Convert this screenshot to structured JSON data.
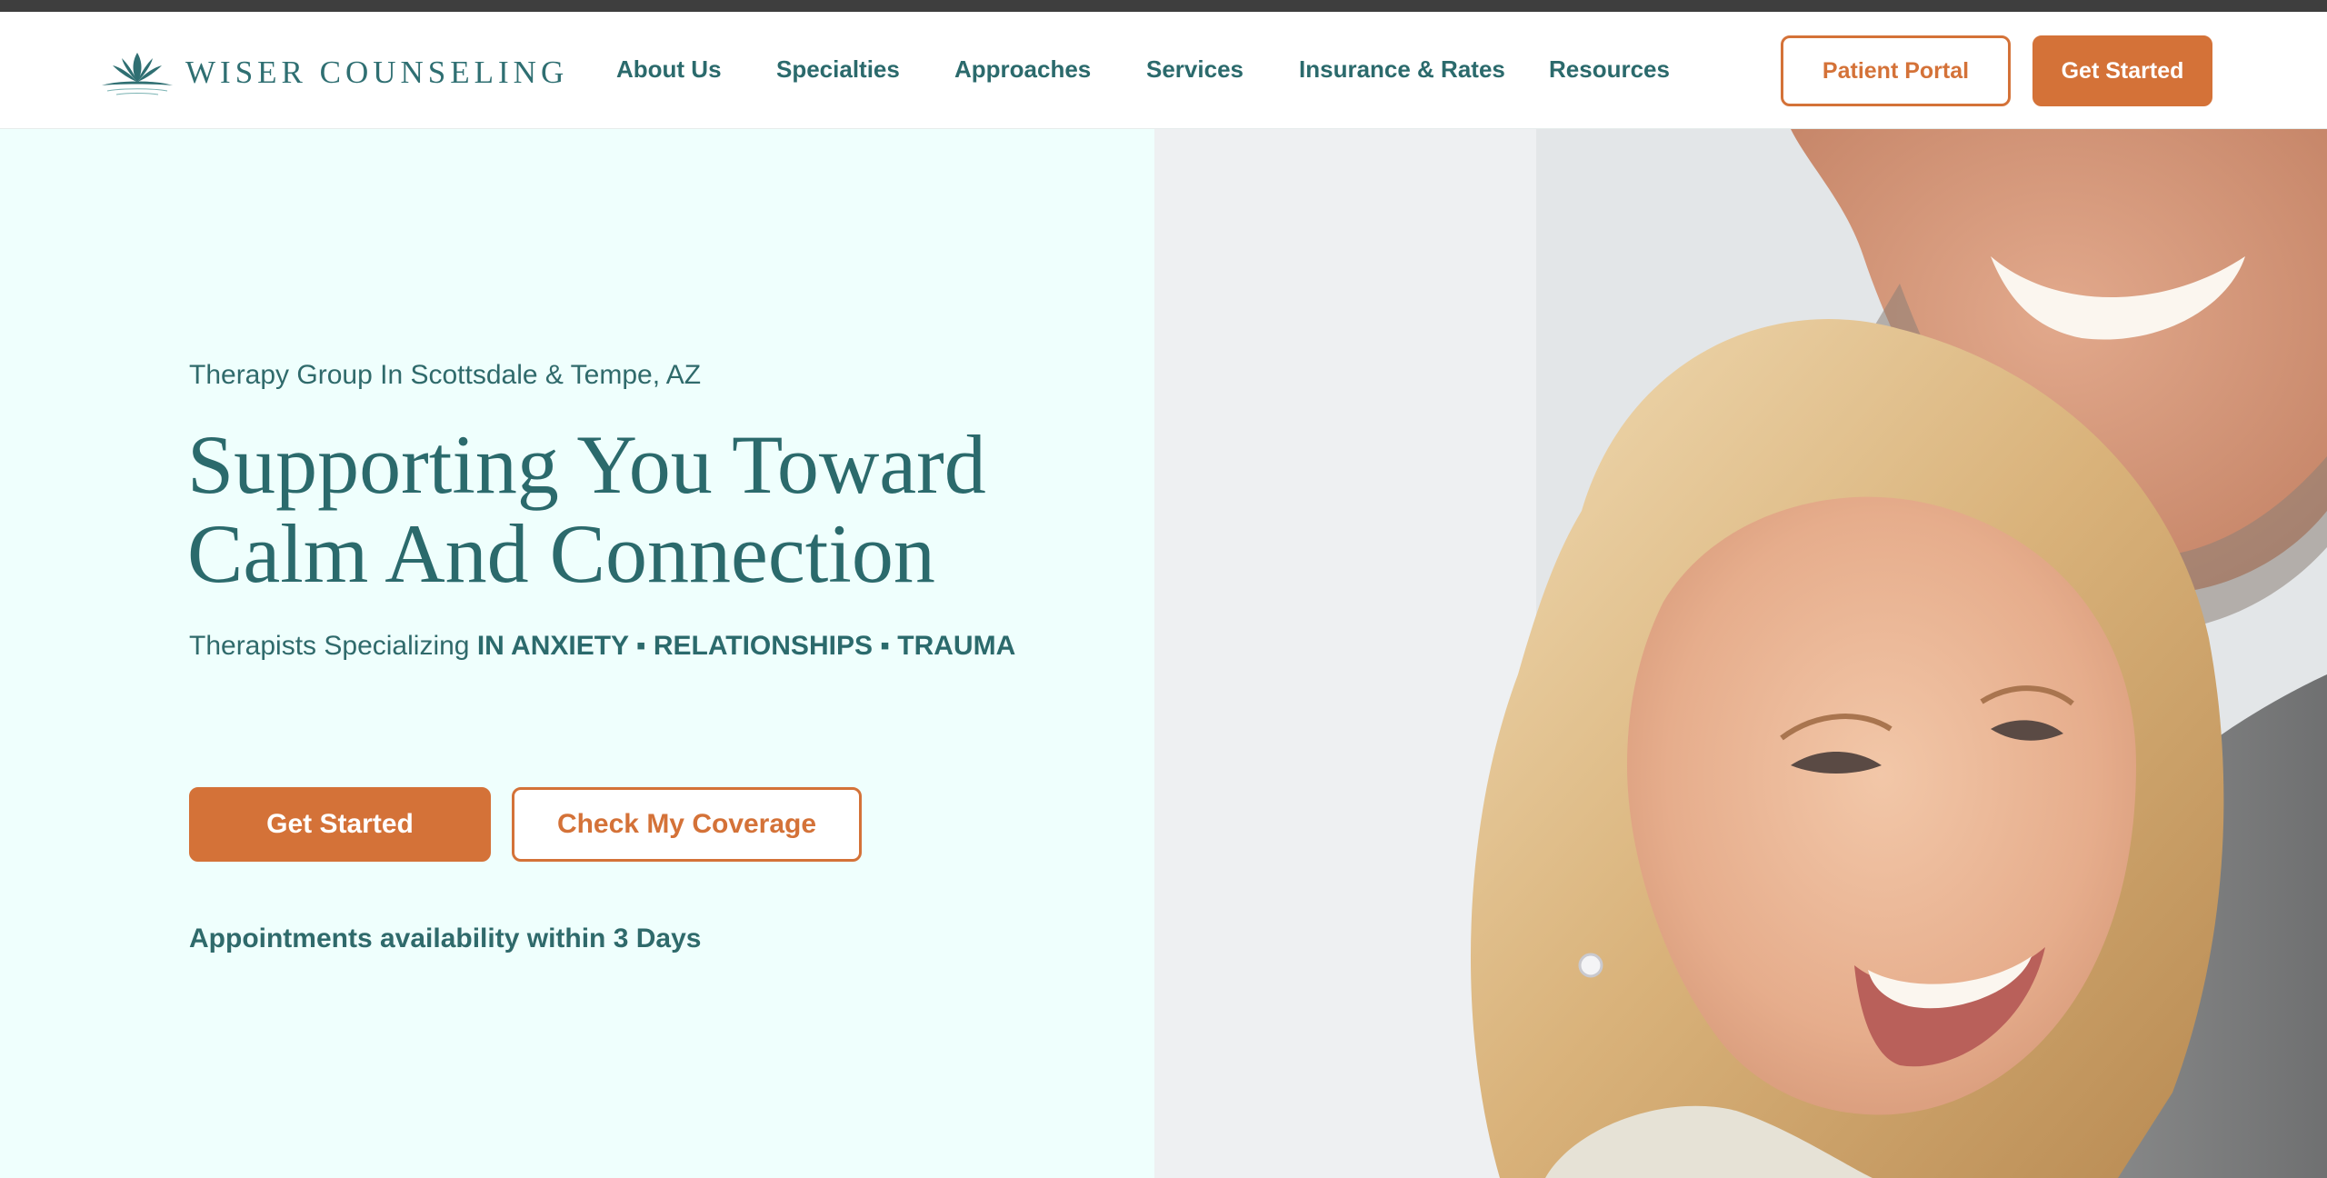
{
  "logo": {
    "text": "WISER COUNSELING",
    "icon": "lotus-icon"
  },
  "nav": {
    "items": [
      {
        "label": "About Us"
      },
      {
        "label": "Specialties"
      },
      {
        "label": "Approaches"
      },
      {
        "label": "Services"
      },
      {
        "label": "Insurance & Rates"
      },
      {
        "label": "Resources"
      }
    ],
    "patient_portal_label": "Patient Portal",
    "get_started_label": "Get Started"
  },
  "hero": {
    "eyebrow": "Therapy Group In Scottsdale & Tempe, AZ",
    "headline_line1": "Supporting You Toward",
    "headline_line2": "Calm And Connection",
    "subline_prefix": "Therapists Specializing",
    "subline_specialties": "IN ANXIETY ▪ RELATIONSHIPS ▪ TRAUMA",
    "get_started_label": "Get Started",
    "check_coverage_label": "Check My Coverage",
    "availability": "Appointments availability within 3 Days",
    "photo_alt": "smiling-couple-embracing"
  },
  "colors": {
    "brand_teal": "#2b6a6c",
    "accent_orange": "#d47238",
    "hero_background": "#effffd",
    "topbar": "#3e3e3e"
  }
}
